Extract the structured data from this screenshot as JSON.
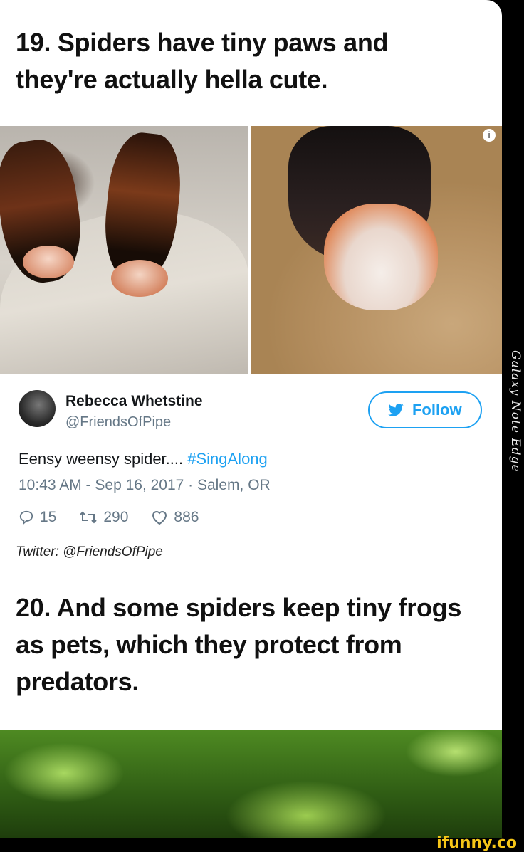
{
  "heading_19": "19. Spiders have tiny paws and they're actually hella cute.",
  "tweet": {
    "author_name": "Rebecca Whetstine",
    "author_handle": "@FriendsOfPipe",
    "follow_label": "Follow",
    "text": "Eensy weensy spider.... ",
    "hashtag": "#SingAlong",
    "meta": "10:43 AM - Sep 16, 2017 · Salem, OR",
    "stats": {
      "replies": "15",
      "retweets": "290",
      "likes": "886"
    }
  },
  "credit": "Twitter: @FriendsOfPipe",
  "heading_20": "20. And some spiders keep tiny frogs as pets, which they protect from predators.",
  "device_label": "Galaxy Note Edge",
  "watermark": "ifunny.co",
  "icons": {
    "info": "info-icon",
    "twitter": "twitter-bird-icon",
    "reply": "reply-icon",
    "retweet": "retweet-icon",
    "like": "heart-icon"
  },
  "colors": {
    "twitter_blue": "#1da1f2",
    "meta_gray": "#657786",
    "watermark_yellow": "#f5c518"
  }
}
